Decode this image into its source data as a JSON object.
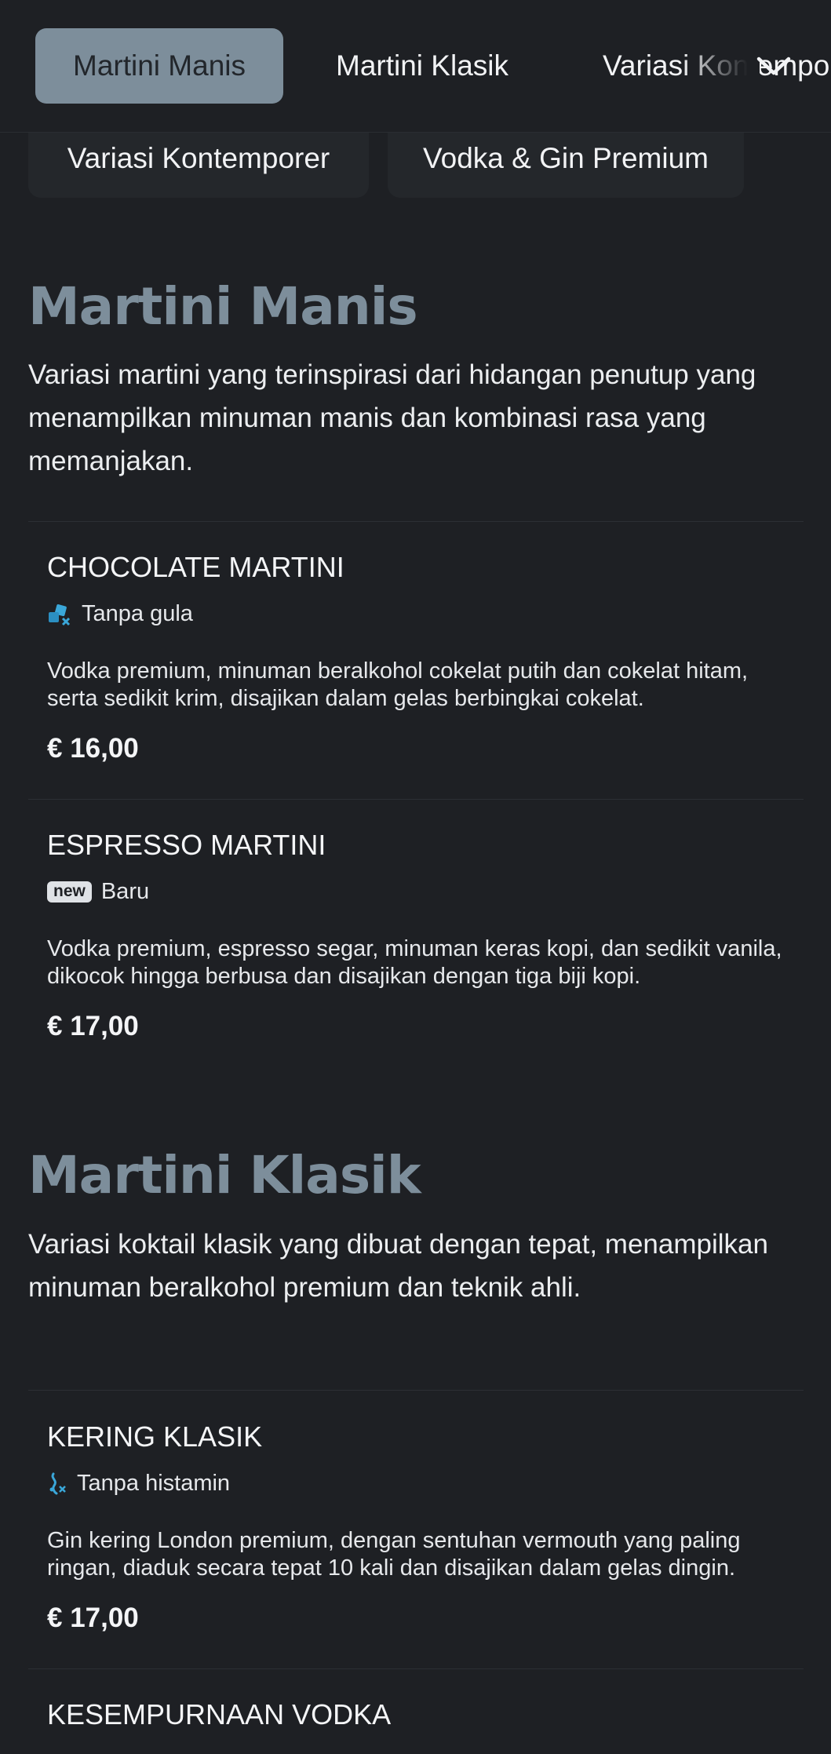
{
  "tabs": [
    {
      "label": "Martini Manis",
      "active": true
    },
    {
      "label": "Martini Klasik",
      "active": false
    },
    {
      "label": "Variasi Kontemporer",
      "active": false
    }
  ],
  "chips": [
    {
      "label": "Variasi Kontemporer"
    },
    {
      "label": "Vodka & Gin Premium"
    }
  ],
  "sections": [
    {
      "title": "Martini Manis",
      "description": "Variasi martini yang terinspirasi dari hidangan penutup yang menampilkan minuman manis dan kombinasi rasa yang memanjakan.",
      "items": [
        {
          "name": "CHOCOLATE MARTINI",
          "tag_icon": "sugar-free-icon",
          "tag": "Tanpa gula",
          "description": "Vodka premium, minuman beralkohol cokelat putih dan cokelat hitam, serta sedikit krim, disajikan dalam gelas berbingkai cokelat.",
          "price": "€ 16,00"
        },
        {
          "name": "ESPRESSO MARTINI",
          "tag_badge": "new",
          "tag": "Baru",
          "description": "Vodka premium, espresso segar, minuman keras kopi, dan sedikit vanila, dikocok hingga berbusa dan disajikan dengan tiga biji kopi.",
          "price": "€ 17,00"
        }
      ]
    },
    {
      "title": "Martini Klasik",
      "description": "Variasi koktail klasik yang dibuat dengan tepat, menampilkan minuman beralkohol premium dan teknik ahli.",
      "items": [
        {
          "name": "KERING KLASIK",
          "tag_icon": "histamine-free-icon",
          "tag": "Tanpa histamin",
          "description": "Gin kering London premium, dengan sentuhan vermouth yang paling ringan, diaduk secara tepat 10 kali dan disajikan dalam gelas dingin.",
          "price": "€ 17,00"
        },
        {
          "name": "KESEMPURNAAN VODKA"
        }
      ]
    }
  ],
  "colors": {
    "background": "#1e2024",
    "accent": "#7d8e9b",
    "icon_blue": "#3aa7d9"
  }
}
